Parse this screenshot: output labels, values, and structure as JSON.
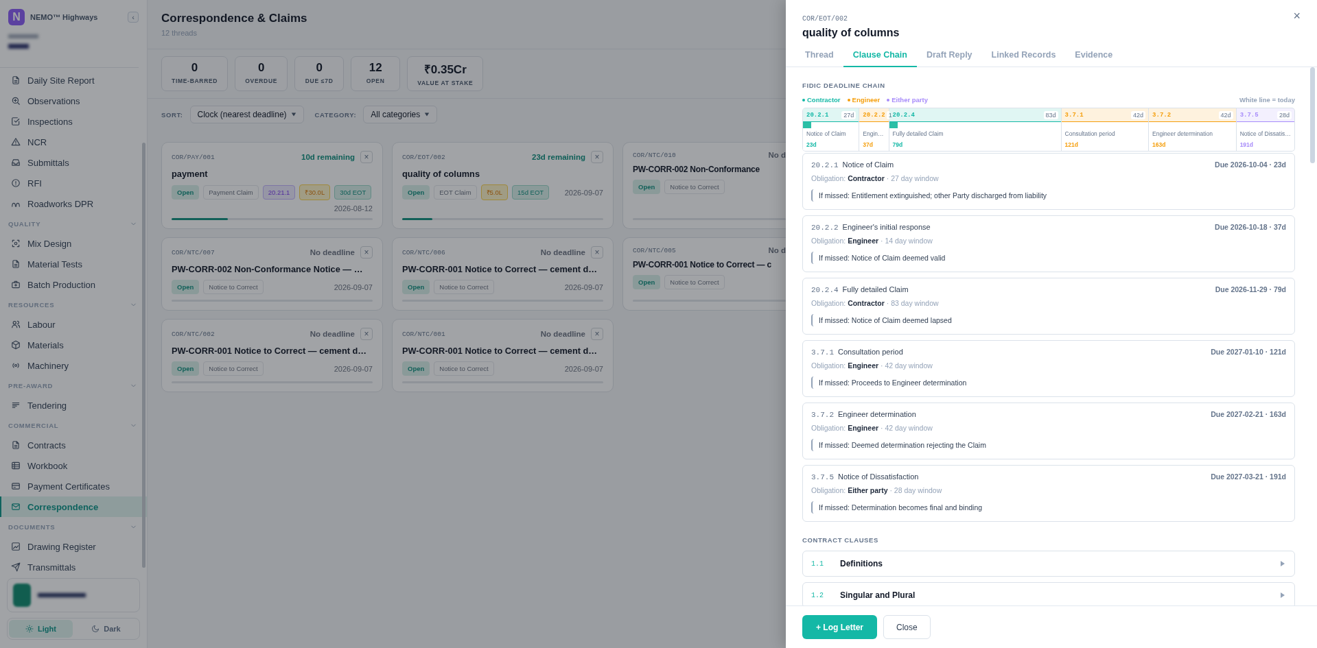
{
  "sidebar": {
    "logo": "N",
    "app_name": "NEMO™ Highways",
    "collapse": "‹",
    "groups": [
      {
        "items": [
          {
            "label": "Daily Site Report",
            "selected": false
          },
          {
            "label": "Observations",
            "selected": false
          },
          {
            "label": "Inspections",
            "selected": false
          },
          {
            "label": "NCR",
            "selected": false
          },
          {
            "label": "Submittals",
            "selected": false
          },
          {
            "label": "RFI",
            "selected": false
          },
          {
            "label": "Roadworks DPR",
            "selected": false
          }
        ]
      },
      {
        "heading": "QUALITY",
        "expanded": true,
        "items": [
          {
            "label": "Mix Design",
            "selected": false
          },
          {
            "label": "Material Tests",
            "selected": false
          },
          {
            "label": "Batch Production",
            "selected": false
          }
        ]
      },
      {
        "heading": "RESOURCES",
        "expanded": true,
        "items": [
          {
            "label": "Labour",
            "selected": false
          },
          {
            "label": "Materials",
            "selected": false
          },
          {
            "label": "Machinery",
            "selected": false
          }
        ]
      },
      {
        "heading": "PRE-AWARD",
        "expanded": true,
        "items": [
          {
            "label": "Tendering",
            "selected": false
          }
        ]
      },
      {
        "heading": "COMMERCIAL",
        "expanded": true,
        "items": [
          {
            "label": "Contracts",
            "selected": false
          },
          {
            "label": "Workbook",
            "selected": false
          },
          {
            "label": "Payment Certificates",
            "selected": false
          },
          {
            "label": "Correspondence",
            "selected": true
          }
        ]
      },
      {
        "heading": "DOCUMENTS",
        "expanded": true,
        "items": [
          {
            "label": "Drawing Register",
            "selected": false
          },
          {
            "label": "Transmittals",
            "selected": false
          }
        ]
      }
    ],
    "theme": [
      {
        "label": "Light",
        "selected": true
      },
      {
        "label": "Dark",
        "selected": false
      }
    ]
  },
  "main": {
    "title": "Correspondence & Claims",
    "subtitle": "12 threads",
    "stats": [
      {
        "value": "0",
        "label": "TIME-BARRED"
      },
      {
        "value": "0",
        "label": "OVERDUE"
      },
      {
        "value": "0",
        "label": "DUE ≤7D"
      },
      {
        "value": "12",
        "label": "OPEN"
      },
      {
        "value": "₹0.35Cr",
        "label": "VALUE AT STAKE"
      }
    ],
    "filters": [
      {
        "label": "SORT:",
        "value": "Clock (nearest deadline)"
      },
      {
        "label": "CATEGORY:",
        "value": "All categories"
      }
    ],
    "cards": [
      {
        "ref": "COR/PAY/001",
        "deadline": "10d remaining",
        "running": true,
        "close": "×",
        "title": "payment",
        "tags": [
          {
            "text": "Open",
            "kind": "status"
          },
          {
            "text": "Payment Claim",
            "kind": "category"
          },
          {
            "text": "20.21.1",
            "kind": "clause"
          },
          {
            "text": "₹30.0L",
            "kind": "amount"
          },
          {
            "text": "30d EOT",
            "kind": "eot"
          }
        ],
        "date": "2026-08-12",
        "level": 0.28
      },
      {
        "ref": "COR/EOT/002",
        "deadline": "23d remaining",
        "running": true,
        "close": "×",
        "title": "quality of columns",
        "tags": [
          {
            "text": "Open",
            "kind": "status"
          },
          {
            "text": "EOT Claim",
            "kind": "category"
          },
          {
            "text": "₹5.0L",
            "kind": "amount"
          },
          {
            "text": "15d EOT",
            "kind": "eot"
          }
        ],
        "date": "2026-09-07",
        "level": 0.15
      },
      {
        "ref": "COR/NTC/010",
        "deadline": "No d",
        "running": false,
        "title": "PW-CORR-002 Non-Conformance",
        "tags": [
          {
            "text": "Open",
            "kind": "status"
          },
          {
            "text": "Notice to Correct",
            "kind": "category"
          }
        ]
      },
      {
        "ref": "COR/NTC/007",
        "deadline": "No deadline",
        "running": false,
        "close": "×",
        "title": "PW-CORR-002 Non-Conformance Notice — …",
        "tags": [
          {
            "text": "Open",
            "kind": "status"
          },
          {
            "text": "Notice to Correct",
            "kind": "category"
          }
        ],
        "date": "2026-09-07"
      },
      {
        "ref": "COR/NTC/006",
        "deadline": "No deadline",
        "running": false,
        "close": "×",
        "title": "PW-CORR-001 Notice to Correct — cement d…",
        "tags": [
          {
            "text": "Open",
            "kind": "status"
          },
          {
            "text": "Notice to Correct",
            "kind": "category"
          }
        ],
        "date": "2026-09-07"
      },
      {
        "ref": "COR/NTC/005",
        "deadline": "No d",
        "running": false,
        "title": "PW-CORR-001 Notice to Correct — c",
        "tags": [
          {
            "text": "Open",
            "kind": "status"
          },
          {
            "text": "Notice to Correct",
            "kind": "category"
          }
        ]
      },
      {
        "ref": "COR/NTC/002",
        "deadline": "No deadline",
        "running": false,
        "close": "×",
        "title": "PW-CORR-001 Notice to Correct — cement d…",
        "tags": [
          {
            "text": "Open",
            "kind": "status"
          },
          {
            "text": "Notice to Correct",
            "kind": "category"
          }
        ],
        "date": "2026-09-07"
      },
      {
        "ref": "COR/NTC/001",
        "deadline": "No deadline",
        "running": false,
        "close": "×",
        "title": "PW-CORR-001 Notice to Correct — cement d…",
        "tags": [
          {
            "text": "Open",
            "kind": "status"
          },
          {
            "text": "Notice to Correct",
            "kind": "category"
          }
        ],
        "date": "2026-09-07"
      }
    ]
  },
  "panel": {
    "ref": "COR/EOT/002",
    "title": "quality of columns",
    "close": "×",
    "tabs": [
      {
        "label": "Thread",
        "selected": false
      },
      {
        "label": "Clause Chain",
        "selected": true
      },
      {
        "label": "Draft Reply",
        "selected": false
      },
      {
        "label": "Linked Records",
        "selected": false
      },
      {
        "label": "Evidence",
        "selected": false
      }
    ],
    "chain_heading": "FIDIC DEADLINE CHAIN",
    "legend": [
      {
        "label": "Contractor",
        "color": "#14b8a6"
      },
      {
        "label": "Engineer",
        "color": "#f59e0b"
      },
      {
        "label": "Either party",
        "color": "#a78bfa"
      }
    ],
    "today_note": "White line = today",
    "chain": [
      {
        "clause": "20.2.1",
        "window": "27d",
        "label": "Notice of Claim",
        "day": "23d",
        "color": "#14b8a6",
        "elapsed": true
      },
      {
        "clause": "20.2.2",
        "window": "1",
        "label": "Engin…",
        "day": "37d",
        "color": "#f59e0b",
        "elapsed": false
      },
      {
        "clause": "20.2.4",
        "window": "83d",
        "label": "Fully detailed Claim",
        "day": "79d",
        "color": "#14b8a6",
        "elapsed": true
      },
      {
        "clause": "3.7.1",
        "window": "42d",
        "label": "Consultation period",
        "day": "121d",
        "color": "#f59e0b",
        "elapsed": false
      },
      {
        "clause": "3.7.2",
        "window": "42d",
        "label": "Engineer determination",
        "day": "163d",
        "color": "#f59e0b",
        "elapsed": false
      },
      {
        "clause": "3.7.5",
        "window": "28d",
        "label": "Notice of Dissatis…",
        "day": "191d",
        "color": "#a78bfa",
        "elapsed": false
      }
    ],
    "deadlines": [
      {
        "clause": "20.2.1",
        "title": "Notice of Claim",
        "due": "Due 2026-10-04 · 23d",
        "obligation": "Obligation: **Contractor** · 27 day window",
        "if_missed": "If missed: Entitlement extinguished; other Party discharged from liability"
      },
      {
        "clause": "20.2.2",
        "title": "Engineer's initial response",
        "due": "Due 2026-10-18 · 37d",
        "obligation": "Obligation: **Engineer** · 14 day window",
        "if_missed": "If missed: Notice of Claim deemed valid"
      },
      {
        "clause": "20.2.4",
        "title": "Fully detailed Claim",
        "due": "Due 2026-11-29 · 79d",
        "obligation": "Obligation: **Contractor** · 83 day window",
        "if_missed": "If missed: Notice of Claim deemed lapsed"
      },
      {
        "clause": "3.7.1",
        "title": "Consultation period",
        "due": "Due 2027-01-10 · 121d",
        "obligation": "Obligation: **Engineer** · 42 day window",
        "if_missed": "If missed: Proceeds to Engineer determination"
      },
      {
        "clause": "3.7.2",
        "title": "Engineer determination",
        "due": "Due 2027-02-21 · 163d",
        "obligation": "Obligation: **Engineer** · 42 day window",
        "if_missed": "If missed: Deemed determination rejecting the Claim"
      },
      {
        "clause": "3.7.5",
        "title": "Notice of Dissatisfaction",
        "due": "Due 2027-03-21 · 191d",
        "obligation": "Obligation: **Either party** · 28 day window",
        "if_missed": "If missed: Determination becomes final and binding"
      }
    ],
    "clauses_heading": "CONTRACT CLAUSES",
    "clauses": [
      {
        "number": "1.1",
        "title": "Definitions",
        "expanded": false
      },
      {
        "number": "1.2",
        "title": "Singular and Plural",
        "expanded": false
      }
    ],
    "actions": [
      {
        "label": "+ Log Letter",
        "kind": "primary"
      },
      {
        "label": "Close",
        "kind": "secondary"
      }
    ]
  }
}
